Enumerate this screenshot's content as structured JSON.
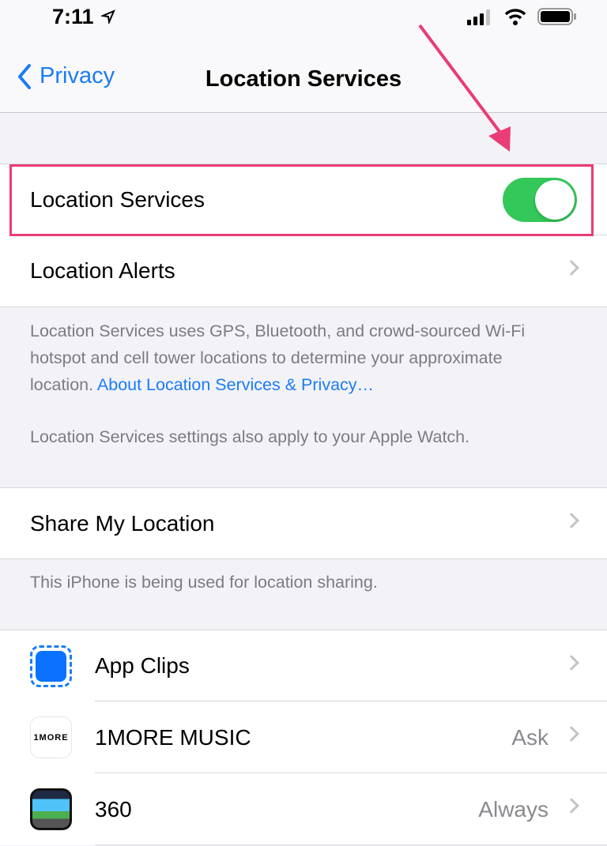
{
  "status_bar": {
    "time": "7:11"
  },
  "nav": {
    "back_label": "Privacy",
    "title": "Location Services"
  },
  "rows": {
    "location_services": {
      "label": "Location Services",
      "enabled": true
    },
    "location_alerts": {
      "label": "Location Alerts"
    },
    "share_my_location": {
      "label": "Share My Location"
    }
  },
  "footers": {
    "location_desc": "Location Services uses GPS, Bluetooth, and crowd-sourced Wi-Fi hotspot and cell tower locations to determine your approximate location.",
    "location_link": "About Location Services & Privacy…",
    "watch_note": "Location Services settings also apply to your Apple Watch.",
    "sharing_note": "This iPhone is being used for location sharing."
  },
  "apps": [
    {
      "name": "App Clips",
      "value": ""
    },
    {
      "name": "1MORE MUSIC",
      "value": "Ask",
      "icon_text": "1MORE"
    },
    {
      "name": "360",
      "value": "Always"
    }
  ],
  "colors": {
    "accent": "#1a7cf5",
    "toggle_on": "#34c759",
    "annotation": "#ea3c77"
  }
}
